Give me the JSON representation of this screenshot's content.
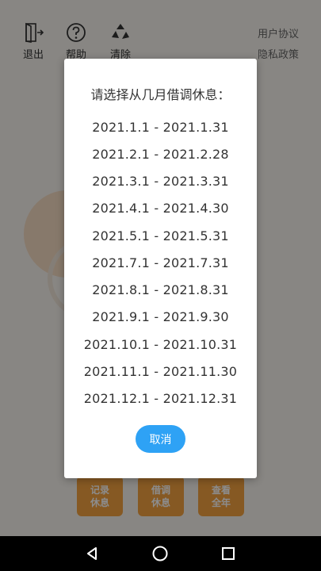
{
  "top_bar": {
    "exit_label": "退出",
    "help_label": "帮助",
    "clear_label": "清除",
    "user_agreement": "用户协议",
    "privacy_policy": "隐私政策"
  },
  "bottom_buttons": [
    {
      "label": "记录\n休息"
    },
    {
      "label": "借调\n休息"
    },
    {
      "label": "查看\n全年"
    }
  ],
  "dialog": {
    "title": "请选择从几月借调休息：",
    "periods": [
      "2021.1.1 - 2021.1.31",
      "2021.2.1 - 2021.2.28",
      "2021.3.1 - 2021.3.31",
      "2021.4.1 - 2021.4.30",
      "2021.5.1 - 2021.5.31",
      "2021.7.1 - 2021.7.31",
      "2021.8.1 - 2021.8.31",
      "2021.9.1 - 2021.9.30",
      "2021.10.1 - 2021.10.31",
      "2021.11.1 - 2021.11.30",
      "2021.12.1 - 2021.12.31"
    ],
    "cancel_label": "取消"
  },
  "colors": {
    "accent_blue": "#2ea2f5",
    "button_orange": "#f4a340"
  },
  "icons": {
    "exit": "exit-door-icon",
    "help": "question-circle-icon",
    "clear": "recycle-icon",
    "nav_back": "triangle-back-icon",
    "nav_home": "circle-home-icon",
    "nav_recent": "square-recent-icon"
  }
}
